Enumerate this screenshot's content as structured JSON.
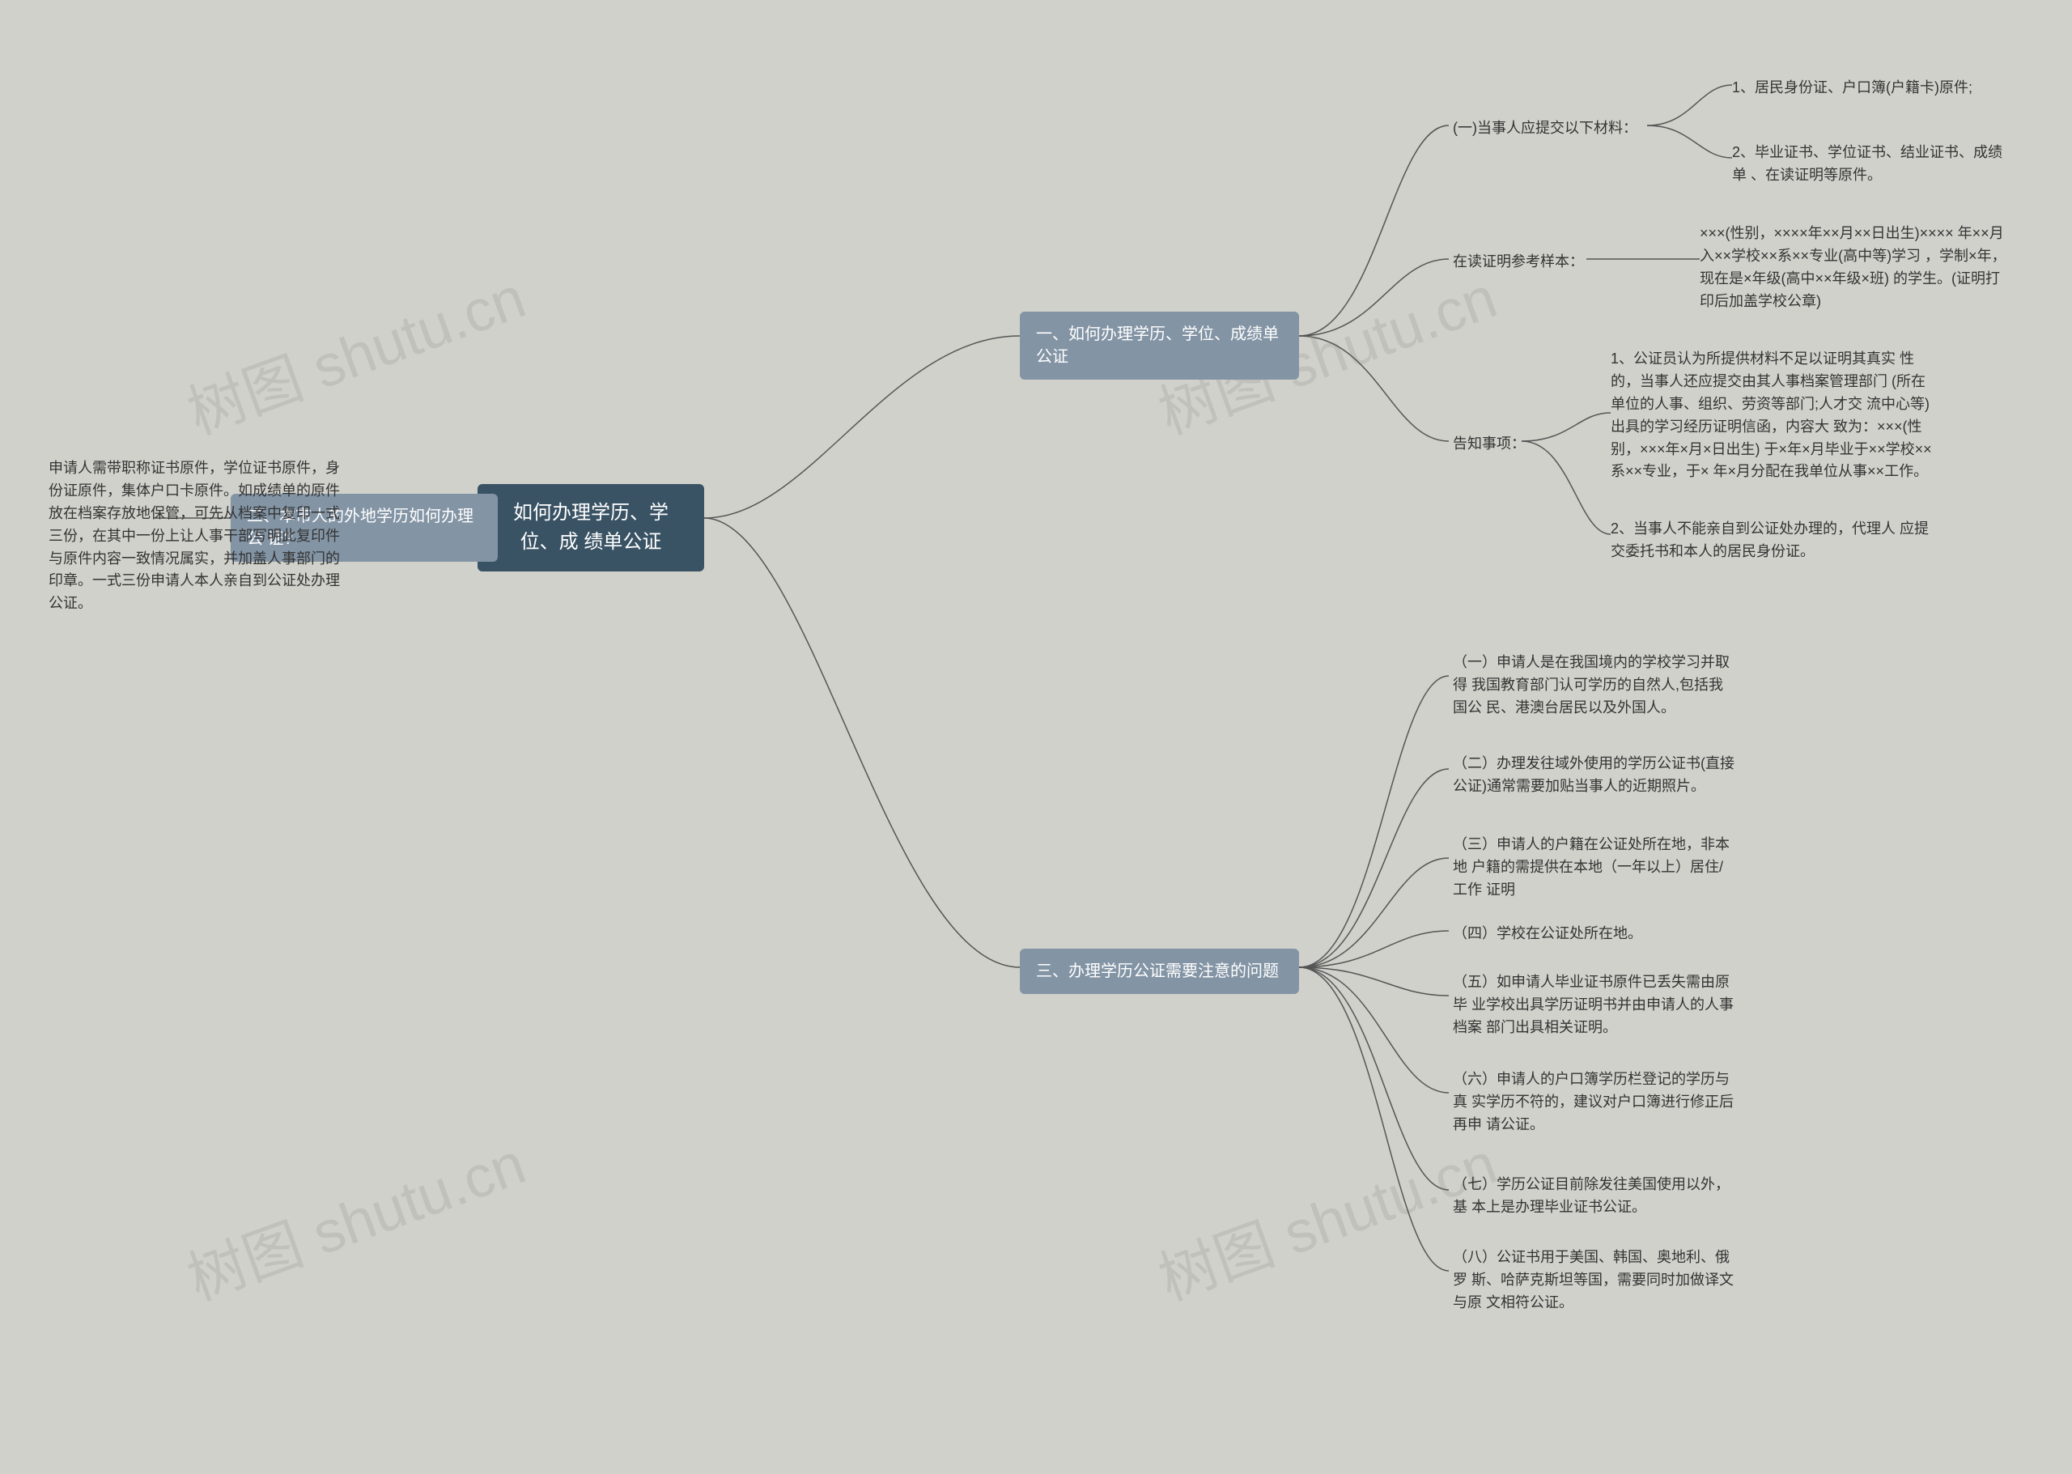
{
  "root": {
    "title": "如何办理学历、学位、成\n绩单公证"
  },
  "branches": {
    "b1": {
      "title": "一、如何办理学历、学位、成绩单\n公证",
      "children": {
        "c1": {
          "label": "(一)当事人应提交以下材料：",
          "leaves": {
            "l1": "1、居民身份证、户口簿(户籍卡)原件;",
            "l2": "2、毕业证书、学位证书、结业证书、成绩单\n、在读证明等原件。"
          }
        },
        "c2": {
          "label": "在读证明参考样本：",
          "leaf": "×××(性别，××××年××月××日出生)××××\n年××月入××学校××系××专业(高中等)学习\n，学制×年，现在是×年级(高中××年级×班)\n的学生。(证明打印后加盖学校公章)"
        },
        "c3": {
          "label": "告知事项：",
          "leaves": {
            "l1": "1、公证员认为所提供材料不足以证明其真实\n性的，当事人还应提交由其人事档案管理部门\n(所在单位的人事、组织、劳资等部门;人才交\n流中心等)出具的学习经历证明信函，内容大\n致为：×××(性别，×××年×月×日出生)\n于×年×月毕业于××学校××系××专业，于×\n年×月分配在我单位从事××工作。",
            "l2": "2、当事人不能亲自到公证处办理的，代理人\n应提交委托书和本人的居民身份证。"
          }
        }
      }
    },
    "b2": {
      "title": "二、本市人的外地学历如何办理公\n证?",
      "leaf": "申请人需带职称证书原件，学位证书原件，身\n份证原件，集体户口卡原件。如成绩单的原件\n放在档案存放地保管，可先从档案中复印一式\n三份，在其中一份上让人事干部写明此复印件\n与原件内容一致情况属实，并加盖人事部门的\n印章。一式三份申请人本人亲自到公证处办理\n公证。"
    },
    "b3": {
      "title": "三、办理学历公证需要注意的问题",
      "leaves": {
        "l1": "（一）申请人是在我国境内的学校学习并取得\n我国教育部门认可学历的自然人,包括我国公\n民、港澳台居民以及外国人。",
        "l2": "（二）办理发往域外使用的学历公证书(直接\n公证)通常需要加贴当事人的近期照片。",
        "l3": "（三）申请人的户籍在公证处所在地，非本地\n户籍的需提供在本地（一年以上）居住/工作\n证明",
        "l4": "（四）学校在公证处所在地。",
        "l5": "（五）如申请人毕业证书原件已丢失需由原毕\n业学校出具学历证明书并由申请人的人事档案\n部门出具相关证明。",
        "l6": "（六）申请人的户口簿学历栏登记的学历与真\n实学历不符的，建议对户口簿进行修正后再申\n请公证。",
        "l7": "（七）学历公证目前除发往美国使用以外，基\n本上是办理毕业证书公证。",
        "l8": "（八）公证书用于美国、韩国、奥地利、俄罗\n斯、哈萨克斯坦等国，需要同时加做译文与原\n文相符公证。"
      }
    }
  },
  "watermarks": {
    "w1": "树图 shutu.cn",
    "w2": "树图 shutu.cn",
    "w3": "树图 shutu.cn",
    "w4": "树图 shutu.cn"
  }
}
